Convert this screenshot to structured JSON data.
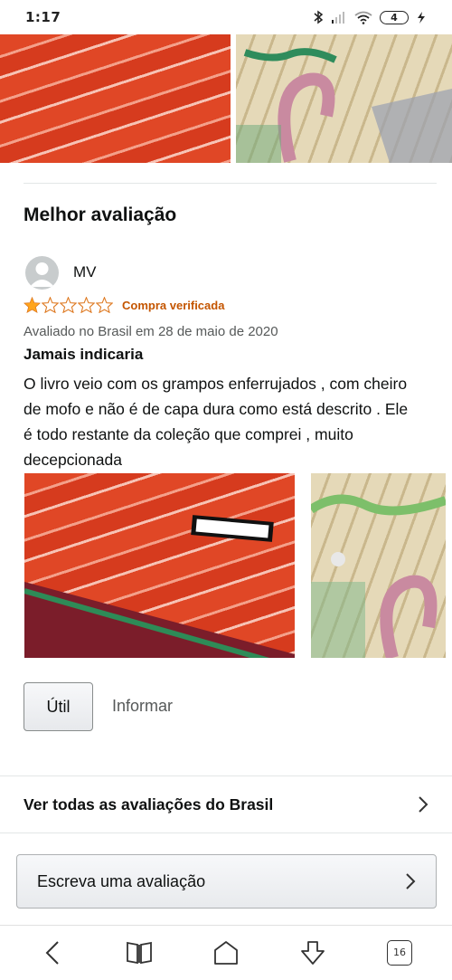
{
  "status_bar": {
    "time": "1:17",
    "battery_level": "4",
    "icons": [
      "bluetooth-icon",
      "signal-icon",
      "wifi-icon",
      "battery-icon",
      "charging-icon"
    ]
  },
  "review": {
    "section_title": "Melhor avaliação",
    "reviewer_name": "MV",
    "rating": 1,
    "rating_max": 5,
    "star_color": "#ffa41c",
    "verified_label": "Compra verificada",
    "date_text": "Avaliado no Brasil em 28 de maio de 2020",
    "headline": "Jamais indicaria",
    "body": "O livro veio com os grampos enferrujados , com cheiro de mofo e não é de capa dura como está descrito . Ele é todo restante da coleção que comprei , muito decepcionada",
    "helpful_button": "Útil",
    "report_link": "Informar"
  },
  "see_all_link": "Ver todas as avaliações do Brasil",
  "write_review_button": "Escreva uma avaliação",
  "bottom_nav": {
    "tab_count": "16",
    "icons": [
      "back-icon",
      "bookmarks-icon",
      "home-icon",
      "download-icon",
      "tabs-icon"
    ]
  },
  "colors": {
    "verified": "#c45500",
    "text": "#0f1111",
    "muted": "#565959"
  }
}
